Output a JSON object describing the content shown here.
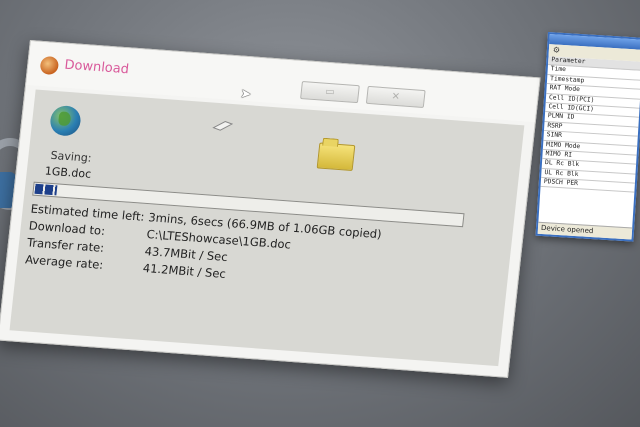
{
  "dialog": {
    "title": "Download",
    "saving_label": "Saving:",
    "file_name": "1GB.doc",
    "progress_fraction": 0.05,
    "details": [
      {
        "label": "Estimated time left:",
        "value": "3mins, 6secs (66.9MB of 1.06GB copied)"
      },
      {
        "label": "Download to:",
        "value": "C:\\LTEShowcase\\1GB.doc"
      },
      {
        "label": "Transfer rate:",
        "value": "43.7MBit / Sec"
      },
      {
        "label": "Average rate:",
        "value": "41.2MBit / Sec"
      }
    ],
    "colors": {
      "title": "#d95a9b",
      "progress": "#1d3f8a"
    },
    "icons": [
      "app-icon",
      "globe-icon",
      "paper-icon",
      "folder-icon",
      "minimize-icon",
      "close-icon",
      "cursor-icon"
    ]
  },
  "side_window": {
    "params": [
      "Parameter",
      "Time",
      "Timestamp",
      "RAT Mode",
      "Cell ID(PCI)",
      "Cell ID(GCI)",
      "PLMN ID",
      "RSRP",
      "SINR",
      "MIMO Mode",
      "MIMO RI",
      "DL Rc Blk",
      "UL Rc Blk",
      "PDSCH PER"
    ],
    "status": "Device opened",
    "colors": {
      "frame": "#3a6fc0"
    }
  }
}
